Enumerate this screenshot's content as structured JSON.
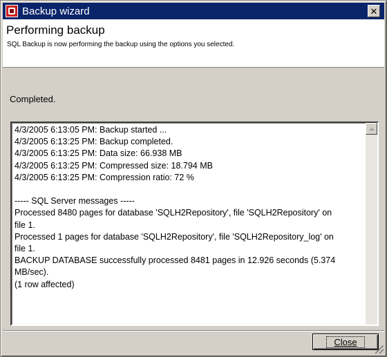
{
  "window": {
    "title": "Backup wizard",
    "close_glyph": "✕"
  },
  "header": {
    "title": "Performing backup",
    "description": "SQL Backup is now performing the backup using the options you selected."
  },
  "status": "Completed.",
  "log": {
    "lines": [
      "4/3/2005 6:13:05 PM: Backup started ...",
      "4/3/2005 6:13:25 PM: Backup completed.",
      "4/3/2005 6:13:25 PM: Data size: 66.938 MB",
      "4/3/2005 6:13:25 PM: Compressed size: 18.794 MB",
      "4/3/2005 6:13:25 PM: Compression ratio: 72 %",
      "",
      "----- SQL Server messages -----",
      "Processed 8480 pages for database 'SQLH2Repository', file 'SQLH2Repository' on",
      "file 1.",
      "Processed 1 pages for database 'SQLH2Repository', file 'SQLH2Repository_log' on",
      "file 1.",
      "BACKUP DATABASE successfully processed 8481 pages in 12.926 seconds (5.374",
      "MB/sec).",
      "(1 row affected)"
    ]
  },
  "buttons": {
    "close_label": "Close"
  },
  "icons": {
    "app": "backup-app-icon",
    "title_close": "close-icon",
    "scroll_up": "arrow-up-icon",
    "grip": "resize-grip-icon"
  }
}
